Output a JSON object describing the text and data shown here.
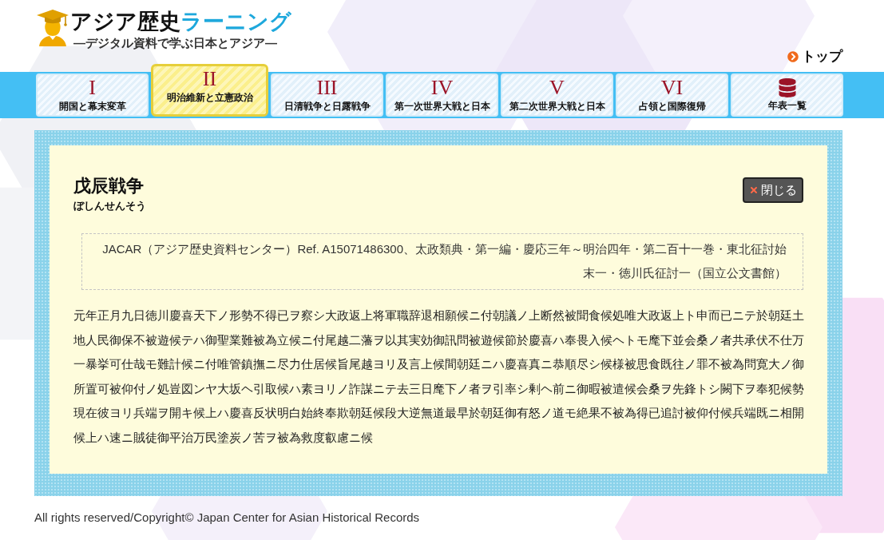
{
  "header": {
    "logo": {
      "title_main": "アジア歴史",
      "title_accent": "ラーニング",
      "tagline": "—デジタル資料で学ぶ日本とアジア—"
    },
    "top_link": "トップ"
  },
  "nav_tabs": [
    {
      "kind": "period",
      "numeral": "I",
      "label": "開国と幕末変革",
      "selected": false
    },
    {
      "kind": "period",
      "numeral": "II",
      "label": "明治維新と立憲政治",
      "selected": true
    },
    {
      "kind": "period",
      "numeral": "III",
      "label": "日清戦争と日露戦争",
      "selected": false
    },
    {
      "kind": "period",
      "numeral": "IV",
      "label": "第一次世界大戦と日本",
      "selected": false
    },
    {
      "kind": "period",
      "numeral": "V",
      "label": "第二次世界大戦と日本",
      "selected": false
    },
    {
      "kind": "period",
      "numeral": "VI",
      "label": "占領と国際復帰",
      "selected": false
    },
    {
      "kind": "timeline",
      "label": "年表一覧",
      "selected": false
    }
  ],
  "article": {
    "title": "戊辰戦争",
    "reading": "ぼしんせんそう",
    "close_button": "閉じる",
    "citation": "JACAR（アジア歴史資料センター）Ref. A15071486300、太政類典・第一編・慶応三年～明治四年・第二百十一巻・東北征討始末一・徳川氏征討一（国立公文書館）",
    "body": "元年正月九日徳川慶喜天下ノ形勢不得已ヲ察シ大政返上将軍職辞退相願候ニ付朝議ノ上断然被聞食候処唯大政返上ト申而已ニテ於朝廷土地人民御保不被遊候テハ御聖業難被為立候ニ付尾越二藩ヲ以其実効御訊問被遊候節於慶喜ハ奉畏入候ヘトモ麾下並会桑ノ者共承伏不仕万一暴挙可仕哉モ難計候ニ付唯管鎮撫ニ尽力仕居候旨尾越ヨリ及言上候間朝廷ニハ慶喜真ニ恭順尽シ候様被思食既往ノ罪不被為問寛大ノ御所置可被仰付ノ処豈図ンヤ大坂ヘ引取候ハ素ヨリノ詐謀ニテ去三日麾下ノ者ヲ引率シ剰ヘ前ニ御暇被遣候会桑ヲ先鋒トシ闕下ヲ奉犯候勢現在彼ヨリ兵端ヲ開キ候上ハ慶喜反状明白始終奉欺朝廷候段大逆無道最早於朝廷御有怒ノ道モ絶果不被為得已追討被仰付候兵端既ニ相開候上ハ速ニ賊徒御平治万民塗炭ノ苦ヲ被為救度叡慮ニ候"
  },
  "footer": "All rights reserved/Copyright© Japan Center for Asian Historical Records"
}
